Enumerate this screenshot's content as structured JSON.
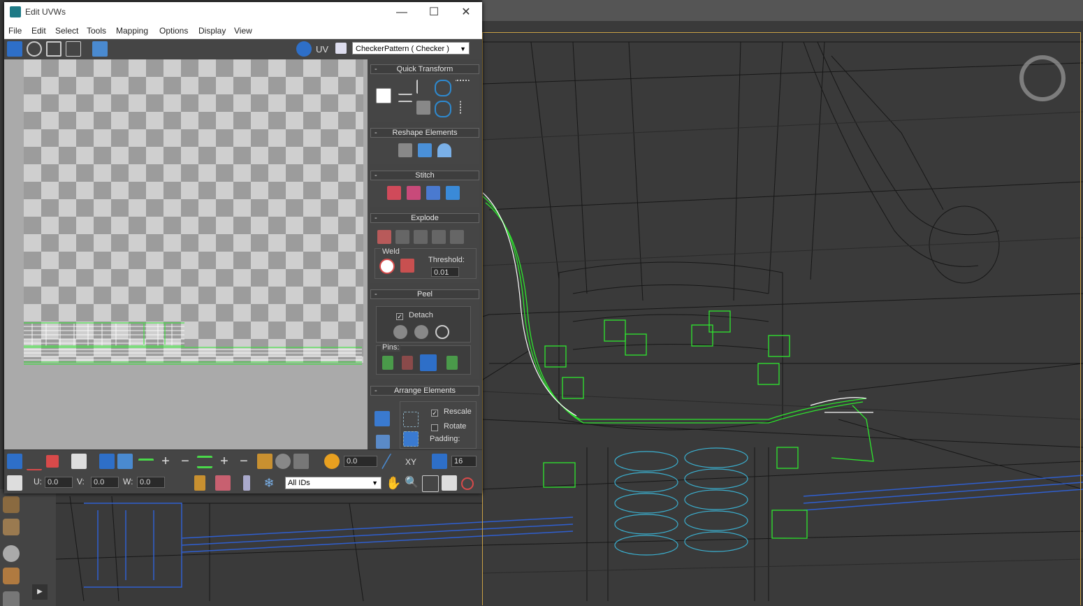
{
  "window": {
    "title": "Edit UVWs",
    "minimize": "—",
    "maximize": "☐",
    "close": "✕"
  },
  "menu": [
    "File",
    "Edit",
    "Select",
    "Tools",
    "Mapping",
    "Options",
    "Display",
    "View"
  ],
  "toolbar": {
    "uv_label": "UV",
    "texture_select": "CheckerPattern  ( Checker )"
  },
  "rollouts": {
    "quick_transform": "Quick Transform",
    "reshape_elements": "Reshape Elements",
    "stitch": "Stitch",
    "explode": "Explode",
    "weld": "Weld",
    "threshold_label": "Threshold:",
    "threshold_value": "0.01",
    "peel": "Peel",
    "detach": "Detach",
    "pins": "Pins:",
    "arrange_elements": "Arrange Elements",
    "rescale": "Rescale",
    "rotate": "Rotate",
    "padding": "Padding:"
  },
  "bottom": {
    "soft_value": "0.0",
    "xy_label": "XY",
    "grid_value": "16",
    "u_label": "U:",
    "u_value": "0.0",
    "v_label": "V:",
    "v_value": "0.0",
    "w_label": "W:",
    "w_value": "0.0",
    "ids_select": "All IDs"
  },
  "colors": {
    "selection_green": "#2ee82e",
    "wire_cyan": "#3ab0d0",
    "wire_blue": "#2f5fd0",
    "frame_gold": "#c9a046"
  }
}
